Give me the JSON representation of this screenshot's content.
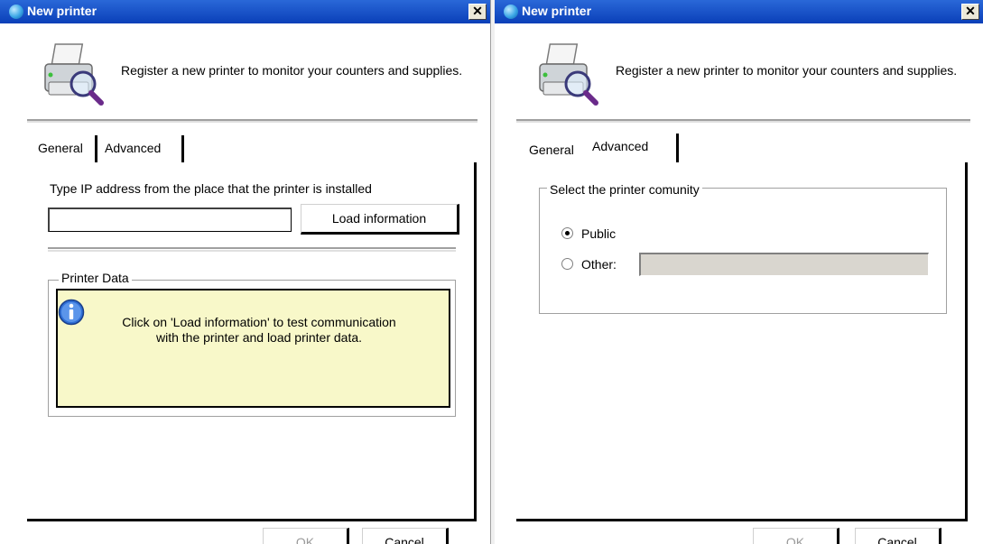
{
  "left_window": {
    "title": "New printer",
    "close_glyph": "✕",
    "header_text": "Register a new printer to monitor your counters and supplies.",
    "tabs": [
      {
        "label": "General",
        "active": true
      },
      {
        "label": "Advanced",
        "active": false
      }
    ],
    "ip_label": "Type IP address from the place that the printer is installed",
    "ip_value": "",
    "load_button": "Load information",
    "group_title": "Printer Data",
    "info_message": "Click on 'Load information' to test communication with the printer and load printer data.",
    "ok_button": "OK",
    "cancel_button": "Cancel"
  },
  "right_window": {
    "title": "New printer",
    "close_glyph": "✕",
    "header_text": "Register a new printer to monitor your counters and supplies.",
    "tabs": [
      {
        "label": "General",
        "active": false
      },
      {
        "label": "Advanced",
        "active": true
      }
    ],
    "group_title": "Select the printer comunity",
    "radio_options": [
      {
        "label": "Public",
        "checked": true
      },
      {
        "label": "Other:",
        "checked": false
      }
    ],
    "other_value": "",
    "ok_button": "OK",
    "cancel_button": "Cancel"
  },
  "icons": {
    "title": "printer-app-icon",
    "header": "printer-search-icon",
    "info": "info-icon"
  },
  "colors": {
    "titlebar": "#0a3fb8",
    "info_bg": "#f8f8c9",
    "disabled_text": "#9a9a9a"
  }
}
